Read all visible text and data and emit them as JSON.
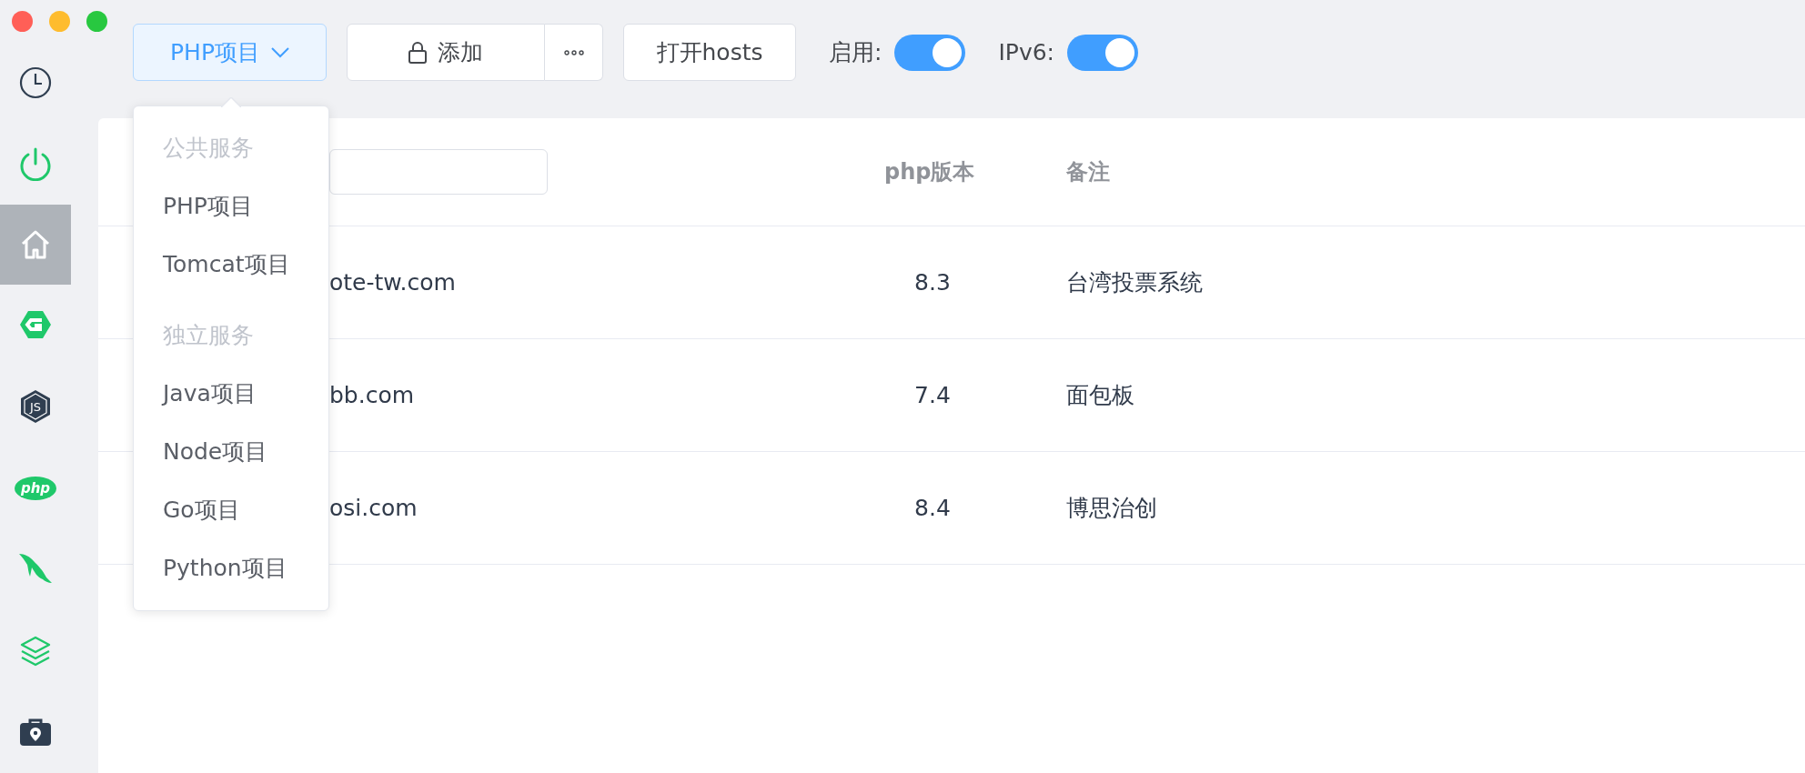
{
  "window": {
    "controls": [
      {
        "kind": "close"
      },
      {
        "kind": "minimize"
      },
      {
        "kind": "zoom"
      }
    ]
  },
  "sidebar": {
    "items": [
      {
        "kind": "clock",
        "selected": false
      },
      {
        "kind": "power",
        "selected": false
      },
      {
        "kind": "home",
        "selected": true
      },
      {
        "kind": "g-logo",
        "selected": false
      },
      {
        "kind": "js-logo",
        "selected": false,
        "glyph": "JS"
      },
      {
        "kind": "php-logo",
        "selected": false,
        "glyph": "php"
      },
      {
        "kind": "dolphin",
        "selected": false
      },
      {
        "kind": "layers",
        "selected": false
      },
      {
        "kind": "toolbox",
        "selected": false
      }
    ]
  },
  "toolbar": {
    "project_type": {
      "label": "PHP项目",
      "expanded": true
    },
    "add_button": "添加",
    "hosts_button": "打开hosts",
    "toggles": [
      {
        "label": "启用:",
        "on": true
      },
      {
        "label": "IPv6:",
        "on": true
      }
    ]
  },
  "dropdown": {
    "groups": [
      {
        "title": "公共服务",
        "items": [
          "PHP项目",
          "Tomcat项目"
        ]
      },
      {
        "title": "独立服务",
        "items": [
          "Java项目",
          "Node项目",
          "Go项目",
          "Python项目"
        ]
      }
    ]
  },
  "table": {
    "columns": [
      "php版本",
      "备注"
    ],
    "rows": [
      {
        "domain": "ote-tw.com",
        "php": "8.3",
        "note": "台湾投票系统"
      },
      {
        "domain": "bb.com",
        "php": "7.4",
        "note": "面包板"
      },
      {
        "domain": "osi.com",
        "php": "8.4",
        "note": "博思治创"
      }
    ]
  }
}
